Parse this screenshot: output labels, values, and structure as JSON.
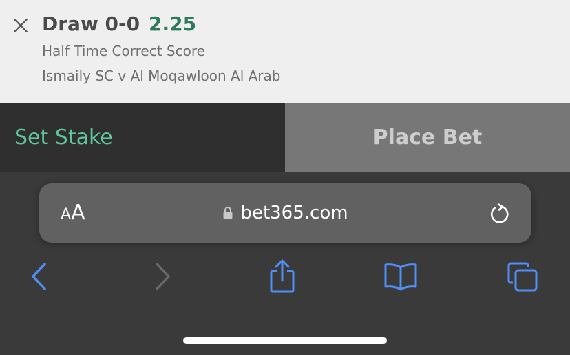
{
  "slip": {
    "selection": "Draw 0-0",
    "odds": "2.25",
    "market": "Half Time Correct Score",
    "fixture": "Ismaily SC v Al Moqawloon Al Arab",
    "close_icon": "close-icon"
  },
  "betbar": {
    "set_stake_label": "Set Stake",
    "place_bet_label": "Place Bet"
  },
  "browser": {
    "text_size_small": "A",
    "text_size_big": "A",
    "domain": "bet365.com",
    "icons": {
      "lock": "lock-icon",
      "reload": "reload-icon",
      "back": "chevron-left-icon",
      "forward": "chevron-right-icon",
      "share": "share-icon",
      "bookmarks": "book-icon",
      "tabs": "tabs-icon"
    }
  },
  "colors": {
    "odds": "#2f7a5b",
    "set_stake": "#5fc59a",
    "toolbar_active": "#4f8ff7",
    "toolbar_disabled": "#6a6a6a"
  }
}
